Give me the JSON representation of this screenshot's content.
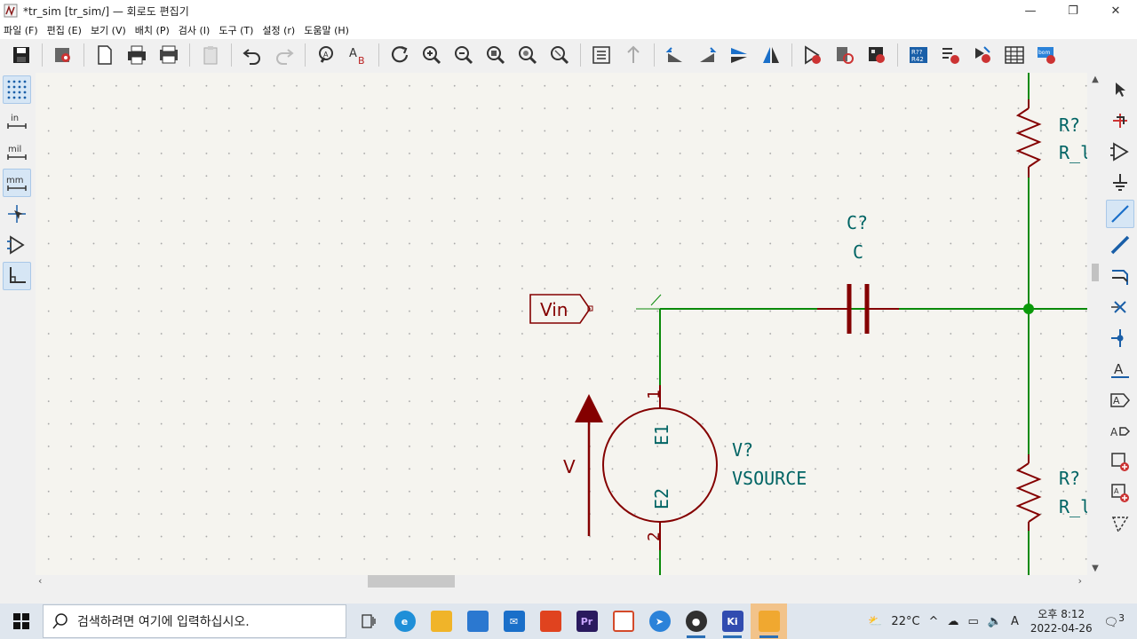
{
  "window": {
    "title": "*tr_sim [tr_sim/] — 회로도 편집기",
    "minimize": "—",
    "maximize": "❐",
    "close": "✕"
  },
  "menu": {
    "items": [
      "파일 (F)",
      "편집 (E)",
      "보기 (V)",
      "배치 (P)",
      "검사 (I)",
      "도구 (T)",
      "설정 (r)",
      "도움말 (H)"
    ]
  },
  "schematic": {
    "vin_label": "Vin",
    "capacitor": {
      "ref": "C?",
      "value": "C"
    },
    "resistor_top": {
      "ref": "R?",
      "value": "R_l"
    },
    "resistor_bottom": {
      "ref": "R?",
      "value": "R_l"
    },
    "vsource": {
      "ref": "V?",
      "value": "VSOURCE",
      "pin1_name": "E1",
      "pin2_name": "E2",
      "pin1_num": "1",
      "pin2_num": "2",
      "arrow_label": "V"
    }
  },
  "taskbar": {
    "search_placeholder": "검색하려면 여기에 입력하십시오.",
    "weather": "22°C",
    "ime": "A",
    "time": "오후 8:12",
    "date": "2022-04-26",
    "notifications": "3",
    "apps": [
      {
        "name": "task-view",
        "label": "",
        "color": "#444444"
      },
      {
        "name": "edge",
        "label": "e",
        "color": "#1f8fd8"
      },
      {
        "name": "file-explorer",
        "label": "",
        "color": "#f0b429"
      },
      {
        "name": "store",
        "label": "",
        "color": "#2b78d0"
      },
      {
        "name": "mail",
        "label": "",
        "color": "#1a6fc9"
      },
      {
        "name": "office",
        "label": "",
        "color": "#e0431f"
      },
      {
        "name": "premiere",
        "label": "Pr",
        "color": "#2a1a5e"
      },
      {
        "name": "photoshop-raw",
        "label": "",
        "color": "#d44a2a"
      },
      {
        "name": "app-blue",
        "label": "",
        "color": "#2b82d9"
      },
      {
        "name": "obs",
        "label": "",
        "color": "#303030"
      },
      {
        "name": "kicad",
        "label": "Ki",
        "color": "#314cb0"
      },
      {
        "name": "file-app",
        "label": "",
        "color": "#f0a830"
      }
    ]
  },
  "colors": {
    "wire": "#008800",
    "symbol": "#840000",
    "text": "#006464",
    "junction": "#00a000"
  }
}
